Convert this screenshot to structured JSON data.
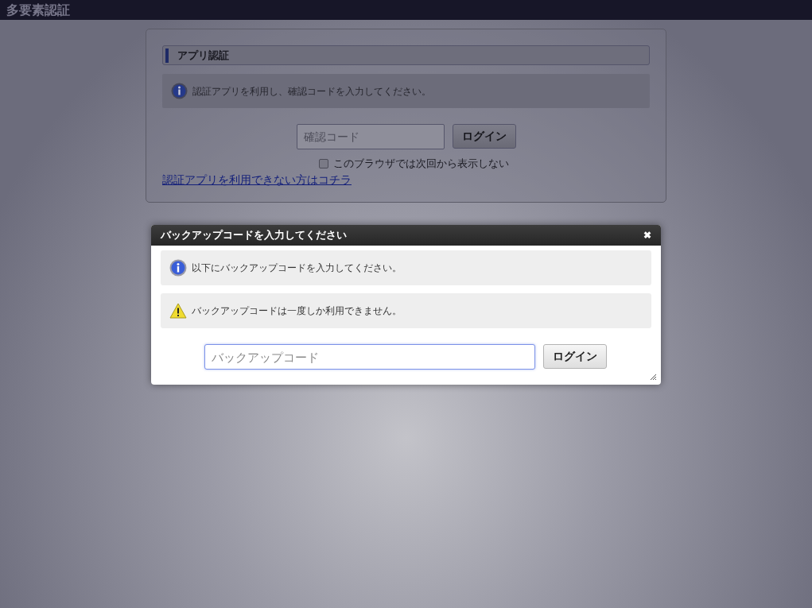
{
  "window": {
    "title": "多要素認証"
  },
  "app_auth": {
    "heading": "アプリ認証",
    "info": "認証アプリを利用し、確認コードを入力してください。",
    "code_field": {
      "placeholder": "確認コード"
    },
    "login_button": "ログイン",
    "remember": {
      "label": "このブラウザでは次回から表示しない",
      "checked": false
    },
    "fallback_link": "認証アプリを利用できない方はコチラ"
  },
  "dialog": {
    "title": "バックアップコードを入力してください",
    "close": "✖",
    "messages": [
      {
        "kind": "info",
        "text": "以下にバックアップコードを入力してください。"
      },
      {
        "kind": "warning",
        "text": "バックアップコードは一度しか利用できません。"
      }
    ],
    "code_field": {
      "placeholder": "バックアップコード"
    },
    "login_button": "ログイン"
  }
}
